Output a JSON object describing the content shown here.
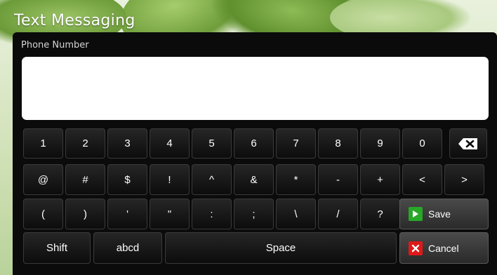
{
  "header": {
    "title": "Text Messaging"
  },
  "phone": {
    "label": "Phone Number",
    "value": "",
    "placeholder": ""
  },
  "keyboard": {
    "row1": [
      {
        "name": "key-1",
        "label": "1"
      },
      {
        "name": "key-2",
        "label": "2"
      },
      {
        "name": "key-3",
        "label": "3"
      },
      {
        "name": "key-4",
        "label": "4"
      },
      {
        "name": "key-5",
        "label": "5"
      },
      {
        "name": "key-6",
        "label": "6"
      },
      {
        "name": "key-7",
        "label": "7"
      },
      {
        "name": "key-8",
        "label": "8"
      },
      {
        "name": "key-9",
        "label": "9"
      },
      {
        "name": "key-0",
        "label": "0"
      }
    ],
    "backspace_icon": "backspace-icon",
    "row2": [
      {
        "name": "key-at",
        "label": "@"
      },
      {
        "name": "key-hash",
        "label": "#"
      },
      {
        "name": "key-dollar",
        "label": "$"
      },
      {
        "name": "key-exclamation",
        "label": "!"
      },
      {
        "name": "key-caret",
        "label": "^"
      },
      {
        "name": "key-ampersand",
        "label": "&"
      },
      {
        "name": "key-asterisk",
        "label": "*"
      },
      {
        "name": "key-minus",
        "label": "-"
      },
      {
        "name": "key-plus",
        "label": "+"
      },
      {
        "name": "key-less-than",
        "label": "<"
      },
      {
        "name": "key-greater-than",
        "label": ">"
      }
    ],
    "row3": [
      {
        "name": "key-open-paren",
        "label": "("
      },
      {
        "name": "key-close-paren",
        "label": ")"
      },
      {
        "name": "key-apostrophe",
        "label": "'"
      },
      {
        "name": "key-quote",
        "label": "\""
      },
      {
        "name": "key-colon",
        "label": ":"
      },
      {
        "name": "key-semicolon",
        "label": ";"
      },
      {
        "name": "key-backslash",
        "label": "\\"
      },
      {
        "name": "key-slash",
        "label": "/"
      },
      {
        "name": "key-question",
        "label": "?"
      }
    ],
    "shift": "Shift",
    "abcd": "abcd",
    "space": "Space"
  },
  "actions": {
    "save": {
      "label": "Save",
      "icon": "play-icon",
      "color": "#27a827"
    },
    "cancel": {
      "label": "Cancel",
      "icon": "close-icon",
      "color": "#e01818"
    }
  },
  "colors": {
    "panel": "#0b0b0b",
    "key": "#1a1a1a",
    "action_key": "#3a3a3a"
  }
}
